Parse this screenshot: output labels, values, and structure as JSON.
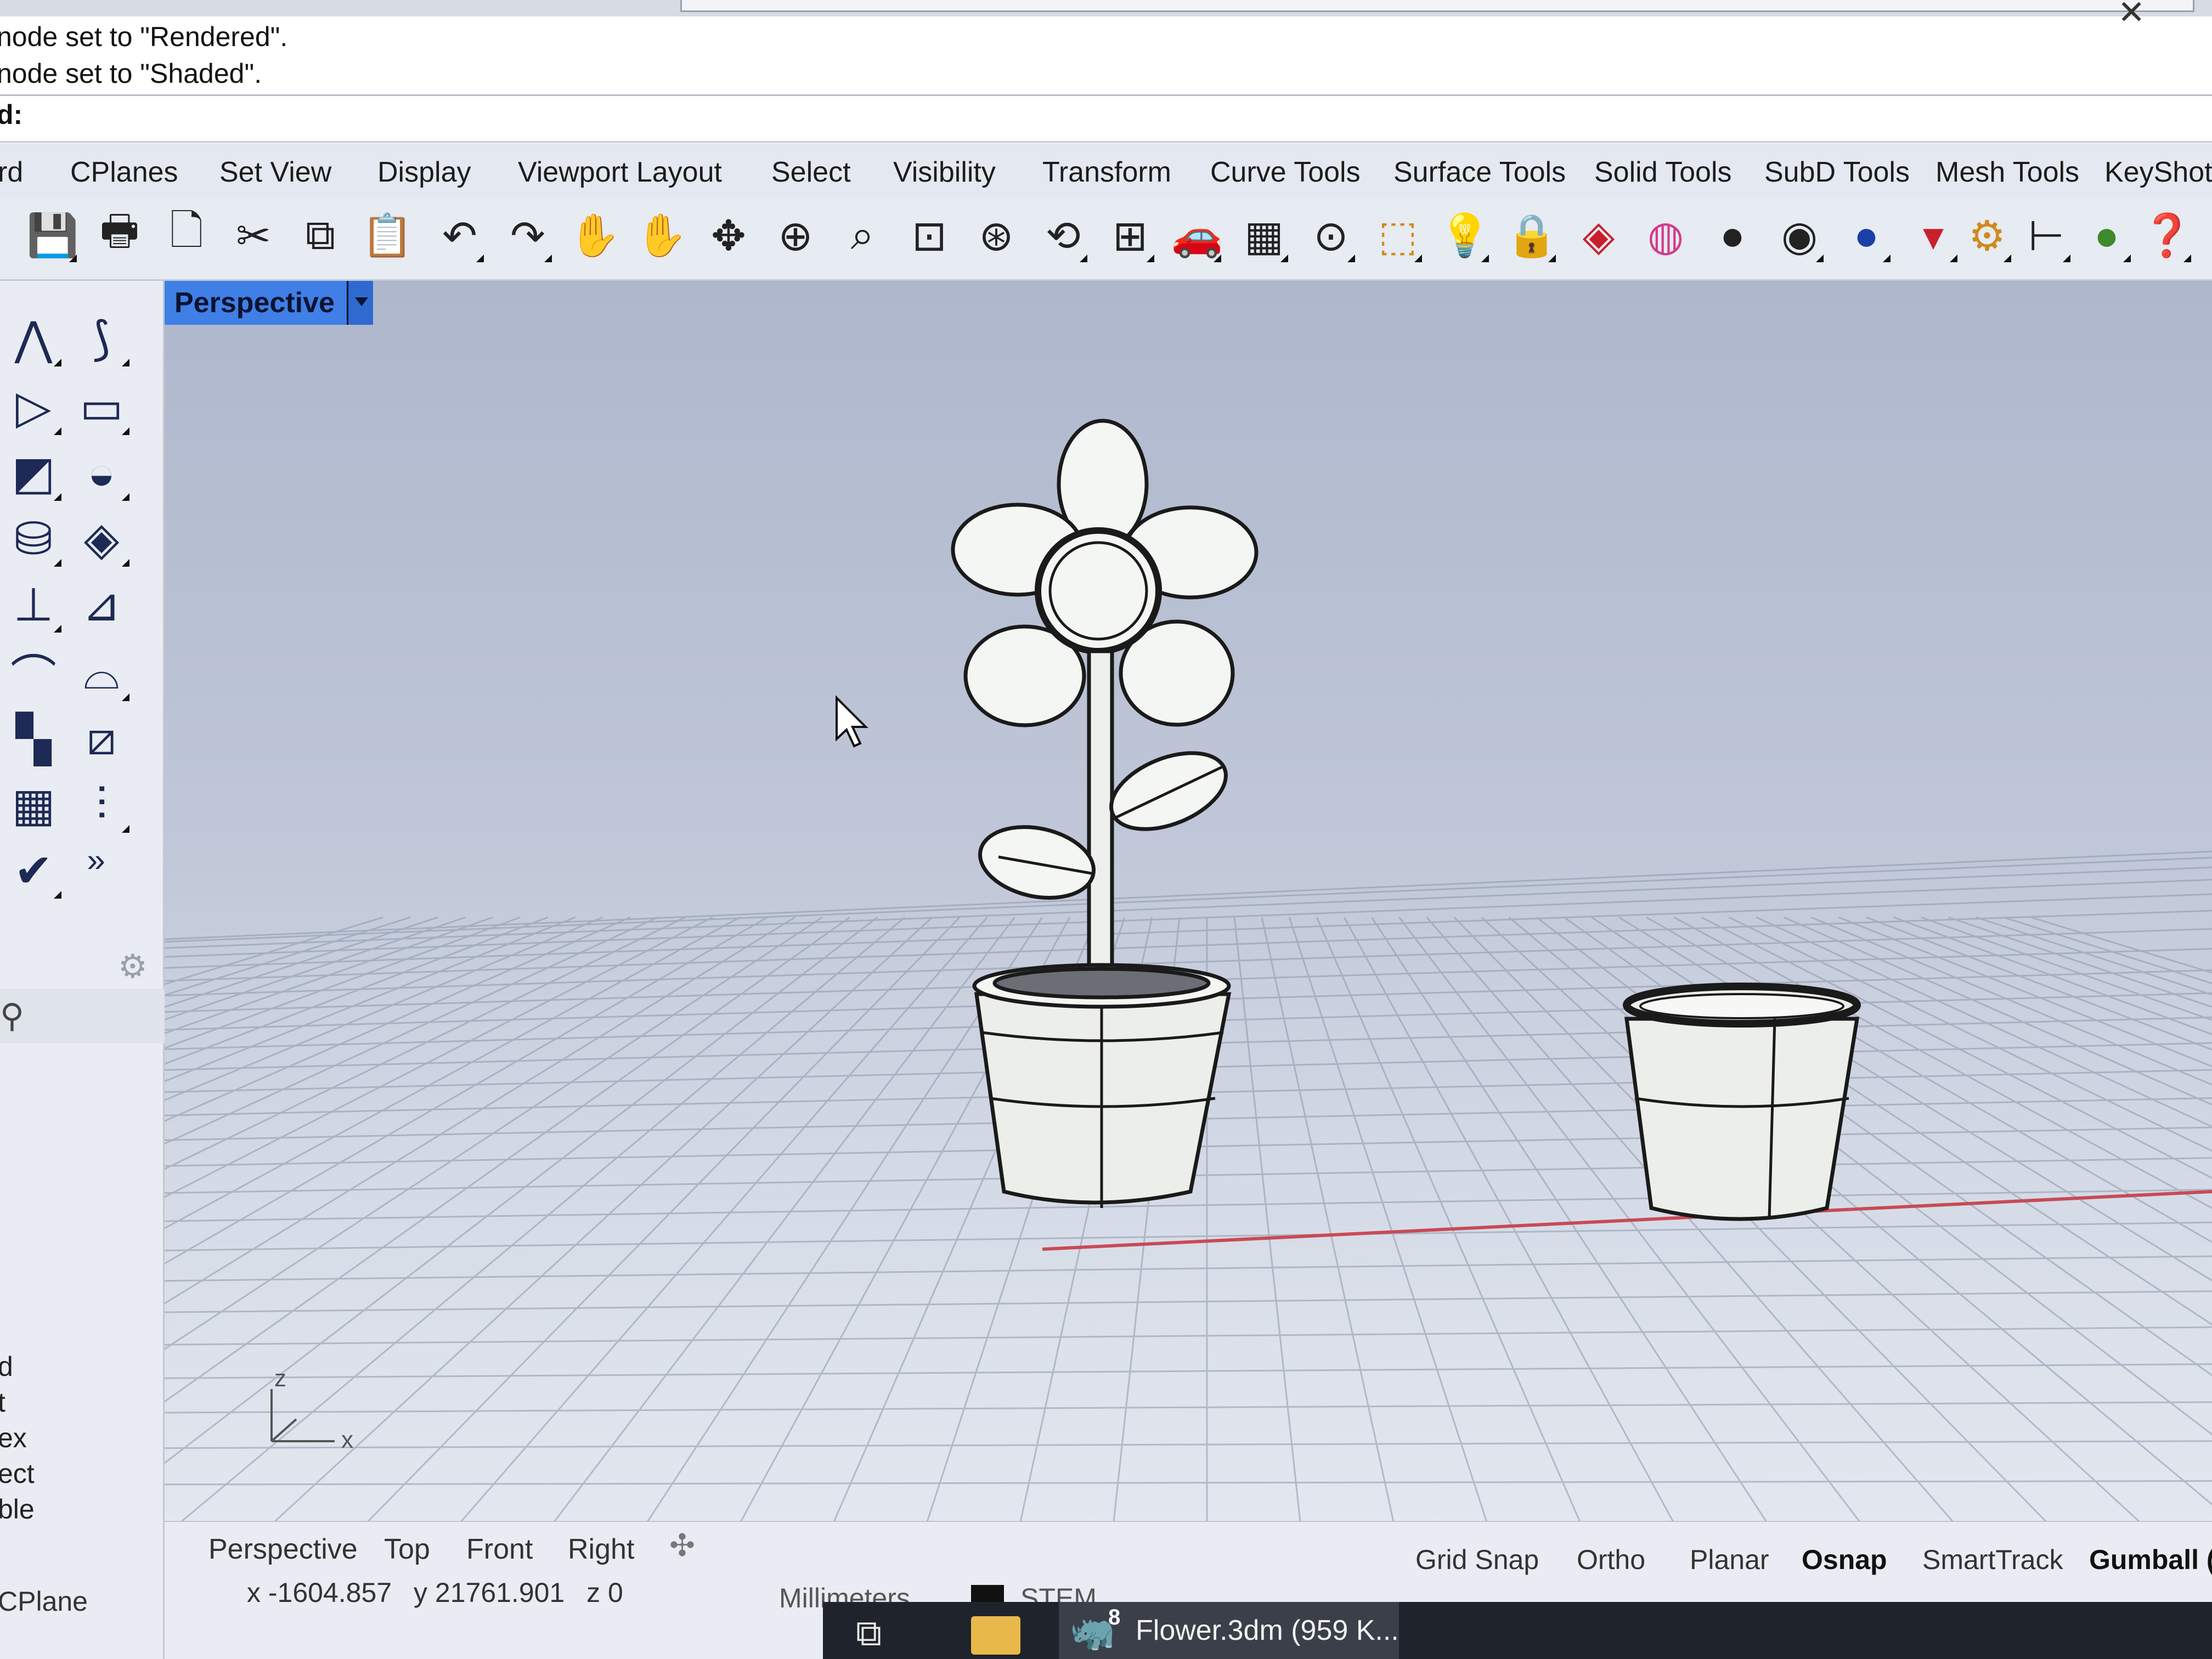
{
  "command_history": {
    "lines": [
      "node set to \"Rendered\".",
      "node set to \"Shaded\"."
    ],
    "prompt": "d:"
  },
  "menu": {
    "tabs": [
      "rd",
      "CPlanes",
      "Set View",
      "Display",
      "Viewport Layout",
      "Select",
      "Visibility",
      "Transform",
      "Curve Tools",
      "Surface Tools",
      "Solid Tools",
      "SubD Tools",
      "Mesh Tools",
      "KeyShot"
    ]
  },
  "toolbar": {
    "icons": [
      "save-icon",
      "print-icon",
      "import-icon",
      "cut-icon",
      "copy-icon",
      "paste-icon",
      "undo-icon",
      "redo-icon",
      "pan-hand-icon",
      "pan-hand-alt-icon",
      "rotate-view-icon",
      "zoom-icon",
      "zoom-window-icon",
      "zoom-extents-icon",
      "zoom-selected-icon",
      "undo-view-icon",
      "four-viewports-icon",
      "car-icon",
      "grid-icon",
      "osnap-icon",
      "shapes-icon",
      "lightbulb-icon",
      "lock-icon",
      "layers-icon",
      "color-wheel-icon",
      "sphere-shaded-icon",
      "render-icon",
      "blue-sphere-icon",
      "draft-angle-icon",
      "gear-settings-icon",
      "dimension-icon",
      "globe-icon",
      "help-icon"
    ]
  },
  "sidebar": {
    "icons": [
      "polyline-icon",
      "curve-icon",
      "circle-icon",
      "rectangle-icon",
      "surface-icon",
      "revolve-icon",
      "box-icon",
      "plane-icon",
      "trim-icon",
      "split-icon",
      "fillet-icon",
      "offset-icon",
      "array-icon",
      "move-icon",
      "grid-array-icon",
      "align-icon",
      "check-icon",
      "more-icon"
    ],
    "more_label": "»",
    "panel_words": [
      "d",
      "t",
      "ex",
      "ect",
      "ble"
    ]
  },
  "viewport": {
    "title": "Perspective",
    "axis_x": "x",
    "axis_z": "z",
    "x_axis_color": "#c84a55",
    "grid_color": "#8d97ab"
  },
  "viewport_tabs": [
    "Perspective",
    "Top",
    "Front",
    "Right"
  ],
  "viewport_tab_add": "✣",
  "status": {
    "cplane": "CPlane",
    "x": "x -1604.857",
    "y": "y 21761.901",
    "z": "z 0",
    "units": "Millimeters",
    "layer": "STEM",
    "layer_color": "#111111",
    "toggles": [
      {
        "label": "Grid Snap",
        "active": false
      },
      {
        "label": "Ortho",
        "active": false
      },
      {
        "label": "Planar",
        "active": false
      },
      {
        "label": "Osnap",
        "active": true
      },
      {
        "label": "SmartTrack",
        "active": false
      },
      {
        "label": "Gumball (V",
        "active": true
      }
    ]
  },
  "taskbar": {
    "rhino_badge": "8",
    "rhino_label": "Flower.3dm (959 K..."
  }
}
